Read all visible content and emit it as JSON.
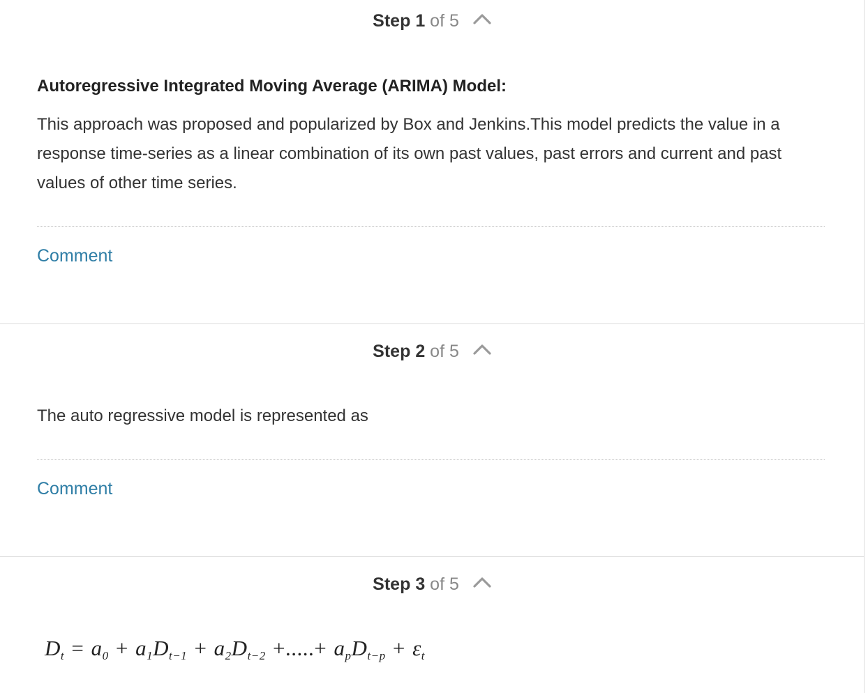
{
  "steps": [
    {
      "word": "Step",
      "number": "1",
      "of_text": "of 5",
      "title": "Autoregressive Integrated Moving Average (ARIMA) Model:",
      "paragraph": "This approach was proposed and popularized by Box and Jenkins.This model predicts the value in a response time-series as a linear combination of its own past values, past errors and current and past values of other time series.",
      "comment_label": "Comment"
    },
    {
      "word": "Step",
      "number": "2",
      "of_text": "of 5",
      "paragraph": "The auto regressive model is represented as",
      "comment_label": "Comment"
    },
    {
      "word": "Step",
      "number": "3",
      "of_text": "of 5",
      "formula": {
        "lhs": "D",
        "lhs_sub": "t",
        "eq": "=",
        "a0": "a",
        "a0_sub": "0",
        "plus": "+",
        "a1": "a",
        "a1_sub": "1",
        "d1": "D",
        "d1_sub": "t−1",
        "a2": "a",
        "a2_sub": "2",
        "d2": "D",
        "d2_sub": "t−2",
        "dots": "+.....+",
        "ap": "a",
        "ap_sub": "p",
        "dp": "D",
        "dp_sub": "t−p",
        "eps": "ε",
        "eps_sub": "t"
      }
    }
  ],
  "icons": {
    "collapse": "chevron-up-icon"
  },
  "colors": {
    "link": "#2f7ea6",
    "muted": "#888888",
    "divider": "#dcdcdc"
  }
}
